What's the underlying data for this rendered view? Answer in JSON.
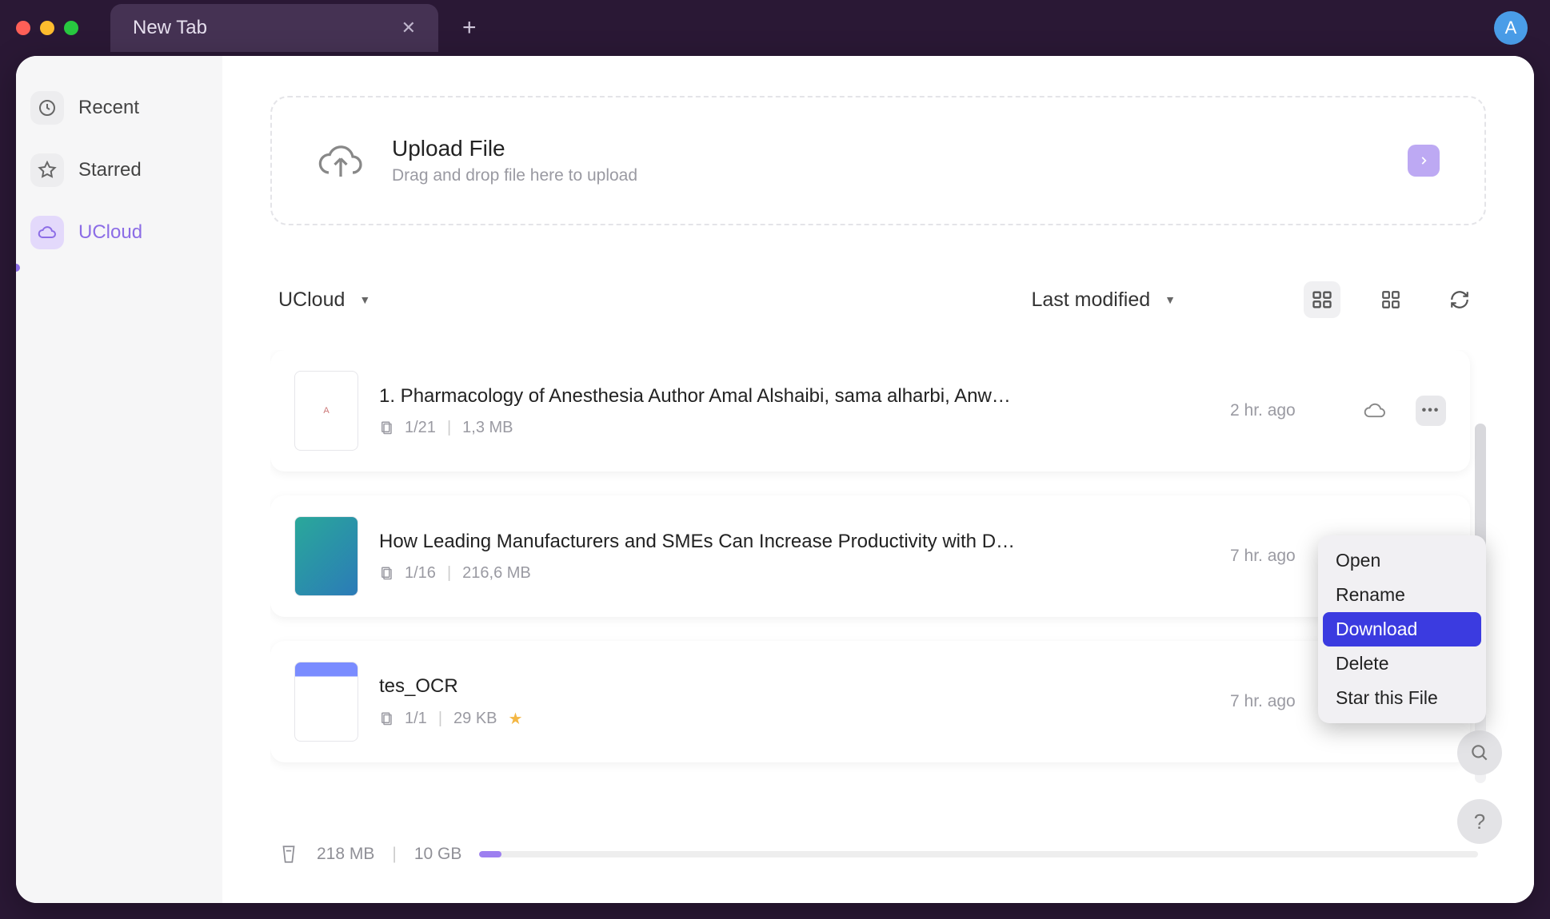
{
  "titlebar": {
    "tab_title": "New Tab",
    "avatar_letter": "A"
  },
  "sidebar": {
    "items": [
      {
        "id": "recent",
        "label": "Recent",
        "icon": "clock-icon"
      },
      {
        "id": "starred",
        "label": "Starred",
        "icon": "star-icon"
      },
      {
        "id": "ucloud",
        "label": "UCloud",
        "icon": "cloud-icon",
        "active": true
      }
    ]
  },
  "upload": {
    "title": "Upload File",
    "subtitle": "Drag and drop file here to upload"
  },
  "toolbar": {
    "location": "UCloud",
    "sort": "Last modified"
  },
  "files": [
    {
      "name": "1. Pharmacology of Anesthesia Author Amal Alshaibi, sama alharbi, Anwa…",
      "pages": "1/21",
      "size": "1,3 MB",
      "time": "2 hr. ago",
      "starred": false,
      "menu_open": true
    },
    {
      "name": "How Leading Manufacturers and SMEs Can Increase Productivity with Di…",
      "pages": "1/16",
      "size": "216,6 MB",
      "time": "7 hr. ago",
      "starred": false,
      "menu_open": false
    },
    {
      "name": "tes_OCR",
      "pages": "1/1",
      "size": "29 KB",
      "time": "7 hr. ago",
      "starred": true,
      "menu_open": false
    }
  ],
  "context_menu": {
    "items": [
      "Open",
      "Rename",
      "Download",
      "Delete",
      "Star this File"
    ],
    "highlighted": "Download"
  },
  "storage": {
    "used": "218 MB",
    "total": "10 GB",
    "percent": 2.2
  }
}
